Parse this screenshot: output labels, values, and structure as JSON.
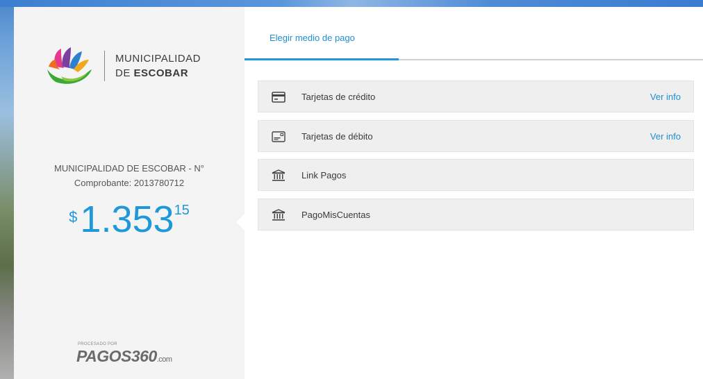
{
  "brand": {
    "logo_line1": "MUNICIPALIDAD",
    "logo_line2_prefix": "DE ",
    "logo_line2_bold": "ESCOBAR"
  },
  "payment": {
    "description_line1": "MUNICIPALIDAD DE ESCOBAR - N°",
    "description_line2": "Comprobante: 2013780712",
    "currency": "$",
    "amount_int": "1.353",
    "amount_dec": "15"
  },
  "footer": {
    "processed_by": "PROCESADO POR",
    "provider": "PAGOS360",
    "provider_suffix": ".com"
  },
  "tabs": [
    {
      "label": "Elegir medio de pago",
      "active": true
    }
  ],
  "options": [
    {
      "label": "Tarjetas de crédito",
      "link": "Ver info",
      "icon": "credit-card-icon"
    },
    {
      "label": "Tarjetas de débito",
      "link": "Ver info",
      "icon": "debit-card-icon"
    },
    {
      "label": "Link Pagos",
      "link": "",
      "icon": "bank-icon"
    },
    {
      "label": "PagoMisCuentas",
      "link": "",
      "icon": "bank-icon"
    }
  ],
  "colors": {
    "accent": "#1e98d8",
    "panel": "#f4f4f4",
    "option_bg": "#efefef"
  }
}
